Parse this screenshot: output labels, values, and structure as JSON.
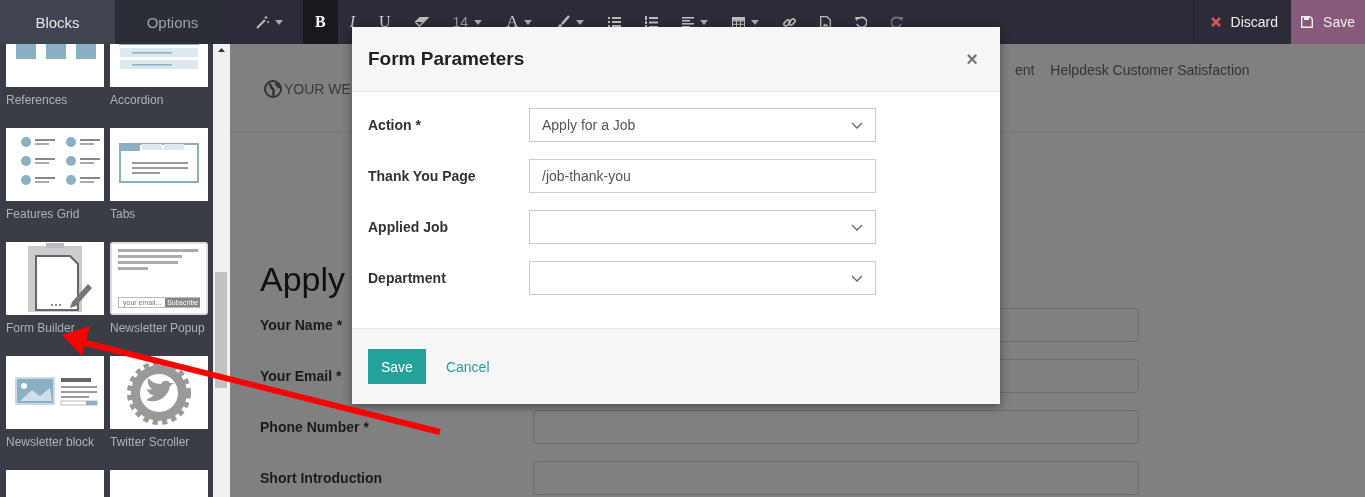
{
  "sidebar": {
    "tabs": [
      {
        "label": "Blocks",
        "selected": true
      },
      {
        "label": "Options",
        "selected": false
      }
    ],
    "blocks": [
      {
        "kind": "references",
        "label": "References"
      },
      {
        "kind": "accordion",
        "label": "Accordion"
      },
      {
        "kind": "features-grid",
        "label": "Features Grid"
      },
      {
        "kind": "tabs",
        "label": "Tabs"
      },
      {
        "kind": "form-builder",
        "label": "Form Builder"
      },
      {
        "kind": "newsletter-popup",
        "label": "Newsletter Popup",
        "placeholder": "your email...",
        "button": "Subscribe"
      },
      {
        "kind": "newsletter-block",
        "label": "Newsletter block"
      },
      {
        "kind": "twitter-scroller",
        "label": "Twitter Scroller"
      },
      {
        "kind": "cut-off"
      },
      {
        "kind": "cut-off"
      }
    ]
  },
  "toolbar": {
    "items": [
      {
        "kind": "wand",
        "caret": true,
        "active": false
      },
      {
        "kind": "bold",
        "label": "B",
        "caret": false,
        "active": true
      },
      {
        "kind": "italic",
        "label": "I",
        "caret": false,
        "active": false
      },
      {
        "kind": "underline",
        "label": "U",
        "caret": false,
        "active": false
      },
      {
        "kind": "eraser",
        "caret": false,
        "active": false
      },
      {
        "kind": "font-size",
        "label": "14",
        "caret": true,
        "active": false
      },
      {
        "kind": "font-color",
        "label": "A",
        "caret": true,
        "active": false
      },
      {
        "kind": "brush",
        "caret": true,
        "active": false
      },
      {
        "kind": "bullet-list",
        "caret": false,
        "active": false
      },
      {
        "kind": "number-list",
        "caret": false,
        "active": false
      },
      {
        "kind": "align",
        "caret": true,
        "active": false
      },
      {
        "kind": "table",
        "caret": true,
        "active": false
      },
      {
        "kind": "link",
        "caret": false,
        "active": false
      },
      {
        "kind": "image",
        "caret": false,
        "active": false
      },
      {
        "kind": "undo",
        "caret": false,
        "active": false
      },
      {
        "kind": "redo",
        "caret": false,
        "active": false
      }
    ],
    "discard": "Discard",
    "save": "Save"
  },
  "page": {
    "logo": "YOUR WE",
    "nav": [
      "ent",
      "Helpdesk Customer Satisfaction"
    ],
    "heading": "Apply",
    "fields": [
      {
        "label": "Your Name *"
      },
      {
        "label": "Your Email *"
      },
      {
        "label": "Phone Number *"
      },
      {
        "label": "Short Introduction"
      }
    ]
  },
  "dialog": {
    "title": "Form Parameters",
    "close": "×",
    "fields": [
      {
        "label": "Action *",
        "kind": "select",
        "value": "Apply for a Job"
      },
      {
        "label": "Thank You Page",
        "kind": "text",
        "value": "/job-thank-you"
      },
      {
        "label": "Applied Job",
        "kind": "select"
      },
      {
        "label": "Department",
        "kind": "select"
      }
    ],
    "save": "Save",
    "cancel": "Cancel"
  }
}
